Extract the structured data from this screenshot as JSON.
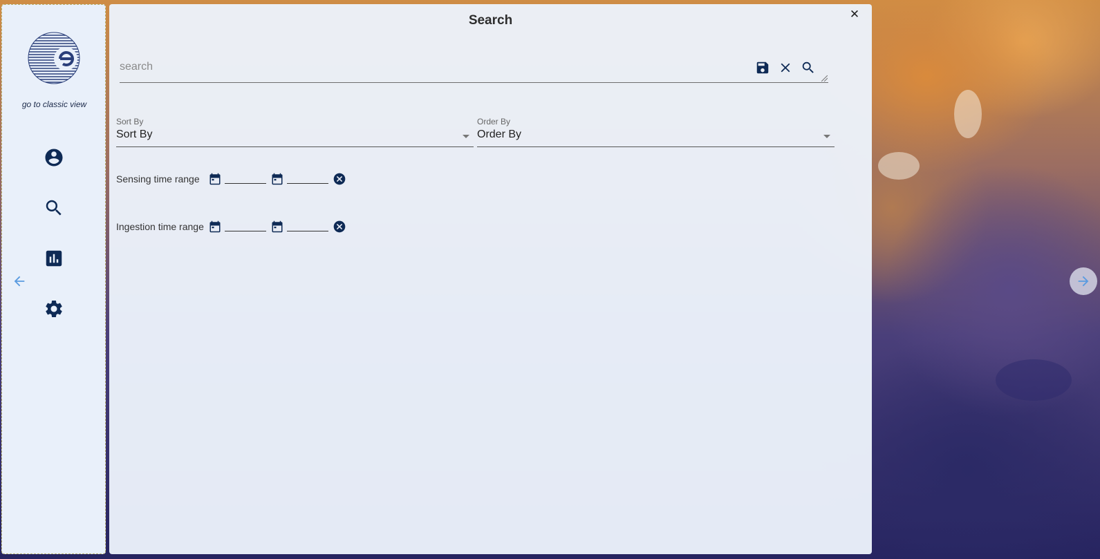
{
  "sidebar": {
    "classic_view_link": "go to classic view",
    "nav": [
      {
        "icon": "account-circle-icon"
      },
      {
        "icon": "search-icon"
      },
      {
        "icon": "bar-chart-icon"
      },
      {
        "icon": "gear-icon"
      }
    ]
  },
  "search_panel": {
    "title": "Search",
    "close_glyph": "✕",
    "search": {
      "placeholder": "search",
      "value": ""
    },
    "sort_by": {
      "label": "Sort By",
      "value": "Sort By"
    },
    "order_by": {
      "label": "Order By",
      "value": "Order By"
    },
    "sensing_range": {
      "label": "Sensing time range"
    },
    "ingestion_range": {
      "label": "Ingestion time range"
    }
  },
  "colors": {
    "icon": "#0e2a55",
    "panel_bg": "#ecf2fb",
    "arrow": "#5a9be0"
  }
}
